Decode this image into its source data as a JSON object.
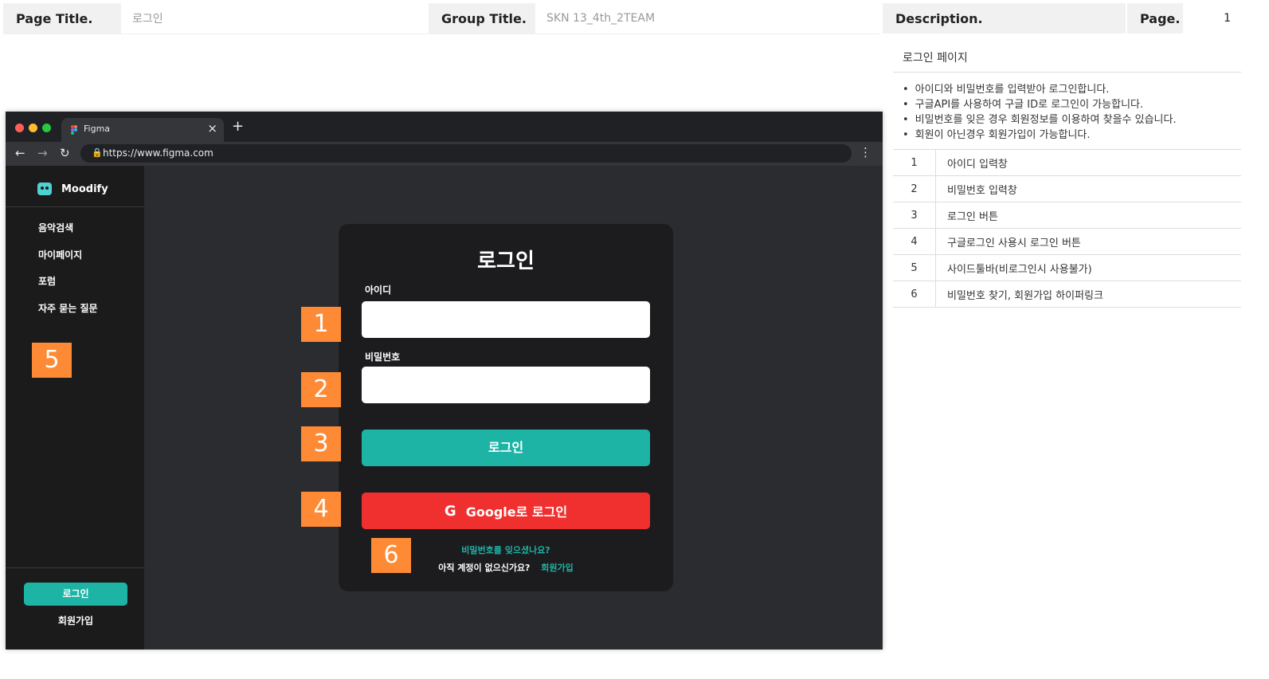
{
  "header": {
    "page_title_label": "Page Title.",
    "page_title_value": "로그인",
    "group_title_label": "Group Title.",
    "group_title_value": "SKN 13_4th_2TEAM",
    "description_label": "Description.",
    "page_label": "Page.",
    "page_value": "1"
  },
  "description": {
    "heading": "로그인 페이지",
    "bullets": [
      "아이디와 비밀번호를 입력받아 로그인합니다.",
      "구글API를 사용하여 구글 ID로 로그인이 가능합니다.",
      "비밀번호를 잊은 경우 회원정보를 이용하여 찾을수 있습니다.",
      "회원이 아닌경우 회원가입이 가능합니다."
    ],
    "rows": [
      {
        "num": "1",
        "text": "아이디 입력창"
      },
      {
        "num": "2",
        "text": "비밀번호 입력창"
      },
      {
        "num": "3",
        "text": "로그인 버튼"
      },
      {
        "num": "4",
        "text": "구글로그인 사용시 로그인 버튼"
      },
      {
        "num": "5",
        "text": "사이드툴바(비로그인시 사용불가)"
      },
      {
        "num": "6",
        "text": "비밀번호 찾기, 회원가입 하이퍼링크"
      }
    ]
  },
  "browser": {
    "tab_title": "Figma",
    "tab_close": "×",
    "new_tab": "+",
    "url": "https://www.figma.com",
    "back": "←",
    "forward": "→",
    "reload": "↻",
    "lock": "🔒",
    "menu": "⋮",
    "colors": {
      "close": "#ff5f57",
      "minimize": "#febc2e",
      "maximize": "#28c840"
    }
  },
  "app": {
    "logo": "Moodify",
    "nav": [
      "음악검색",
      "마이페이지",
      "포럼",
      "자주 묻는 질문"
    ],
    "sidebar_login": "로그인",
    "sidebar_signup": "회원가입",
    "card_title": "로그인",
    "id_label": "아이디",
    "pw_label": "비밀번호",
    "login_button": "로그인",
    "google_icon": "G",
    "google_button": "Google로 로그인",
    "forgot_link": "비밀번호를 잊으셨나요?",
    "no_account": "아직 계정이 없으신가요?",
    "signup_link": "회원가입",
    "accent": "#1db4a6",
    "google_red": "#f0302f"
  },
  "markers": [
    "1",
    "2",
    "3",
    "4",
    "5",
    "6"
  ],
  "marker_color": "#ff8a35"
}
